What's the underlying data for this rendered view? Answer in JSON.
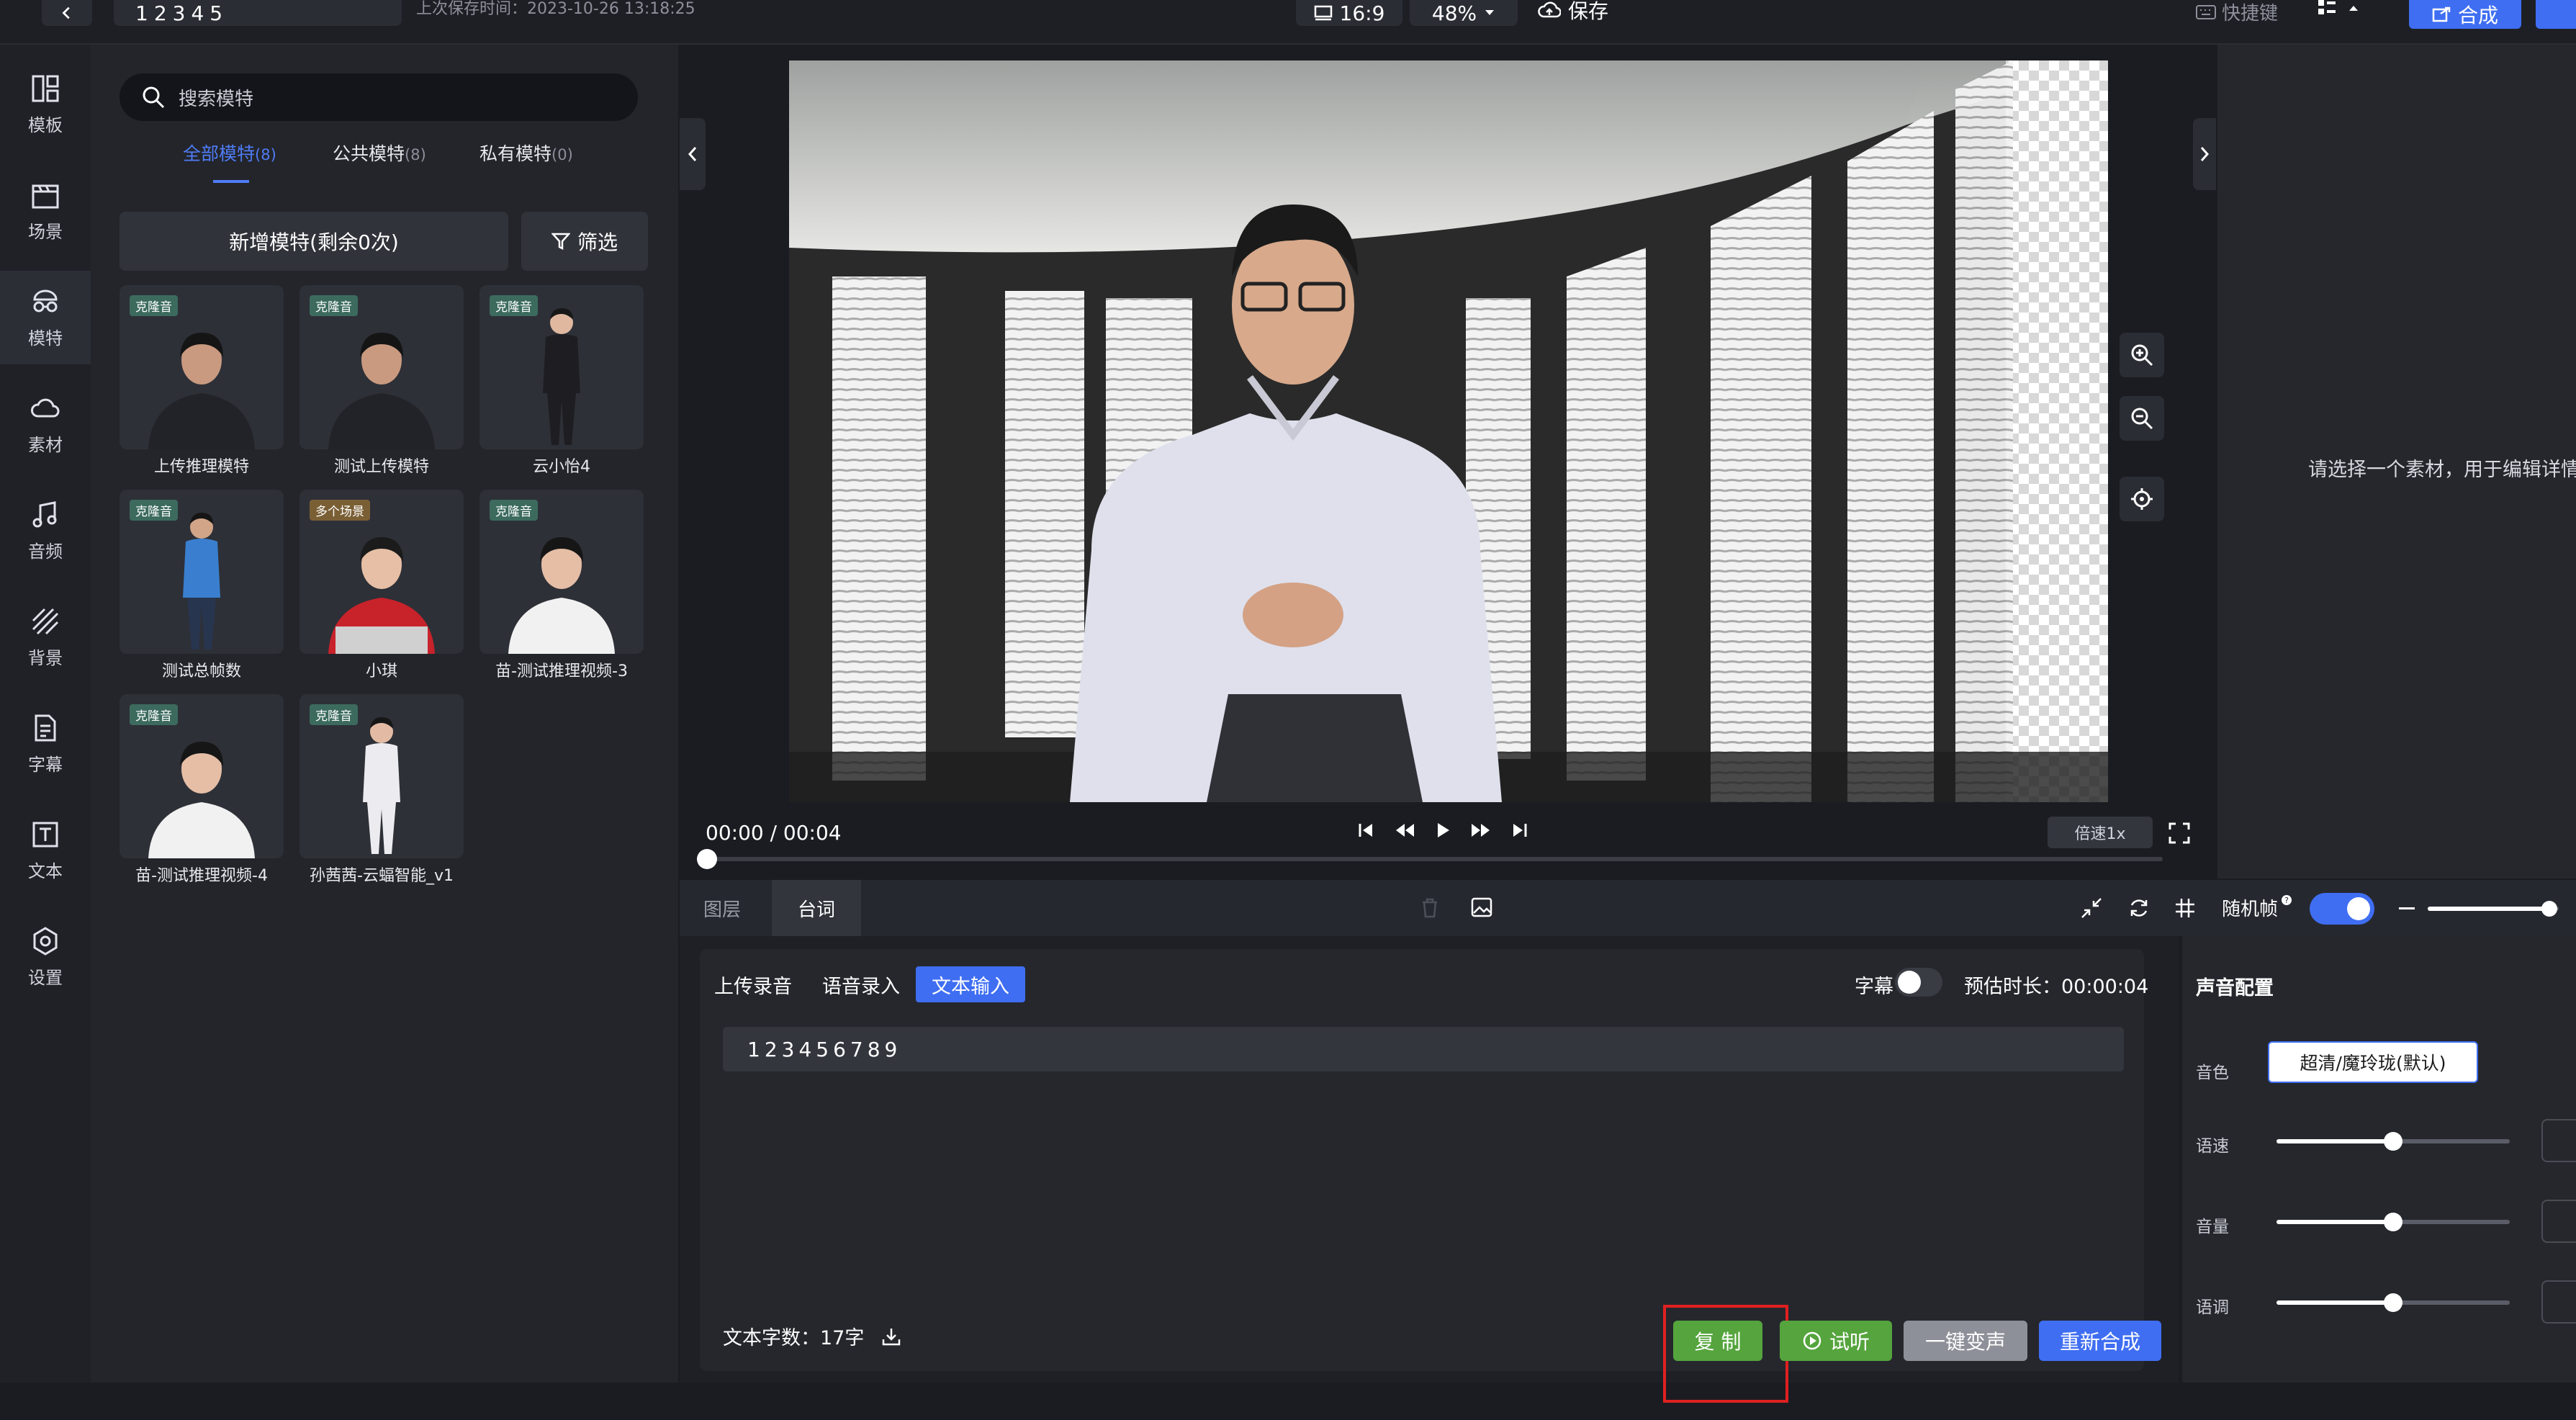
{
  "topbar": {
    "project_name": "12345",
    "last_saved": "上次保存时间：2023-10-26 13:18:25",
    "ratio": "16:9",
    "zoom": "48%",
    "save_label": "保存",
    "shortcut_label": "快捷键",
    "synth_label": "合成"
  },
  "nav": {
    "items": [
      {
        "label": "模板",
        "icon": "template-icon"
      },
      {
        "label": "场景",
        "icon": "scene-icon"
      },
      {
        "label": "模特",
        "icon": "model-icon"
      },
      {
        "label": "素材",
        "icon": "cloud-icon"
      },
      {
        "label": "音频",
        "icon": "music-icon"
      },
      {
        "label": "背景",
        "icon": "background-icon"
      },
      {
        "label": "字幕",
        "icon": "subtitle-icon"
      },
      {
        "label": "文本",
        "icon": "text-icon"
      },
      {
        "label": "设置",
        "icon": "gear-icon"
      }
    ],
    "active_index": 2
  },
  "model_panel": {
    "search_placeholder": "搜索模特",
    "tabs": [
      {
        "label": "全部模特",
        "count": "(8)"
      },
      {
        "label": "公共模特",
        "count": "(8)"
      },
      {
        "label": "私有模特",
        "count": "(0)"
      }
    ],
    "add_label": "新增模特(剩余0次)",
    "filter_label": "筛选",
    "cards": [
      {
        "name": "上传推理模特",
        "tag": "克隆音",
        "figure": "male"
      },
      {
        "name": "测试上传模特",
        "tag": "克隆音",
        "figure": "male"
      },
      {
        "name": "云小怡4",
        "tag": "克隆音",
        "figure": "female-dark"
      },
      {
        "name": "测试总帧数",
        "tag": "克隆音",
        "figure": "male-blue"
      },
      {
        "name": "小琪",
        "tag": "多个场景",
        "figure": "female-red"
      },
      {
        "name": "苗-测试推理视频-3",
        "tag": "克隆音",
        "figure": "female-white"
      },
      {
        "name": "苗-测试推理视频-4",
        "tag": "克隆音",
        "figure": "female-white"
      },
      {
        "name": "孙茜茜-云蝠智能_v1",
        "tag": "克隆音",
        "figure": "female-white2"
      }
    ]
  },
  "player": {
    "time": "00:00 / 00:04",
    "speed": "倍速1x",
    "progress": 0
  },
  "inspector": {
    "empty_hint": "请选择一个素材，用于编辑详情"
  },
  "editor": {
    "tabs": [
      "图层",
      "台词"
    ],
    "active_tab": 1,
    "random_frame_label": "随机帧",
    "random_frame_on": true,
    "input_modes": [
      "上传录音",
      "语音录入",
      "文本输入"
    ],
    "active_mode": 2,
    "subtitle_label": "字幕",
    "subtitle_on": false,
    "duration_label": "预估时长：00:00:04",
    "script_text": "123456789",
    "char_count": "文本字数：17字",
    "buttons": {
      "copy": "复 制",
      "listen": "试听",
      "voice_change": "一键变声",
      "resynth": "重新合成"
    }
  },
  "voice_config": {
    "title": "声音配置",
    "timbre_label": "音色",
    "timbre_value": "超清/魔玲珑(默认)",
    "speed_label": "语速",
    "speed_level": 0.5,
    "volume_label": "音量",
    "volume_level": 0.5,
    "pitch_label": "语调",
    "pitch_level": 0.5
  }
}
